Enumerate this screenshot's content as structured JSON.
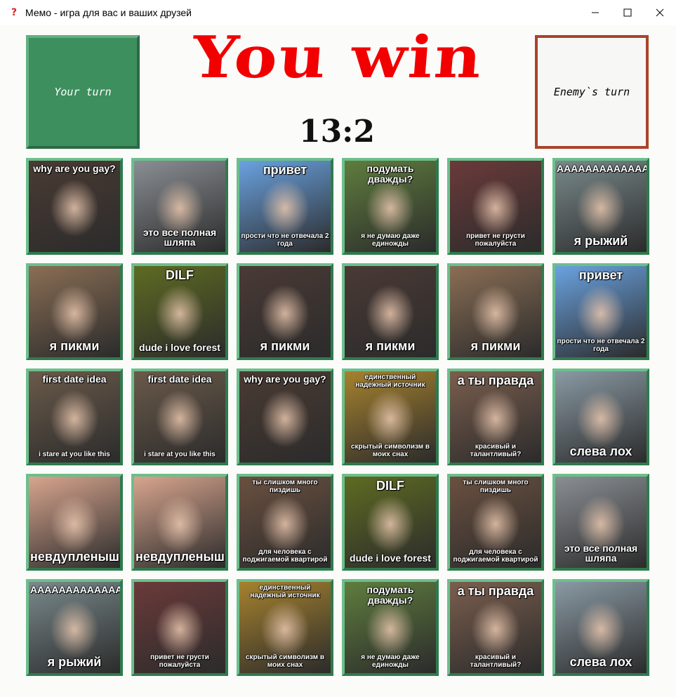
{
  "window": {
    "title": "Мемо - игра для вас и ваших друзей",
    "icon": "question-icon"
  },
  "status": {
    "your_turn_label": "Your turn",
    "enemy_turn_label": "Enemy`s turn",
    "headline": "You win",
    "score": "13:2"
  },
  "colors": {
    "active_turn": "#3d8f5e",
    "enemy_border": "#a9442b",
    "headline": "#f20000",
    "card_border": "#4a9d6a"
  },
  "cards": [
    [
      {
        "top": "why are you gay?",
        "bottom": "",
        "bg": "#4a3b33"
      },
      {
        "top": "",
        "bottom": "это все полная шляпа",
        "bg": "#8a8f94"
      },
      {
        "top": "привет",
        "bottom": "прости что не отвечала 2 года",
        "bg": "#6aa2e0"
      },
      {
        "top": "подумать дважды?",
        "bottom": "я не думаю даже единожды",
        "bg": "#5f7d3e"
      },
      {
        "top": "",
        "bottom": "привет не грусти пожалуйста",
        "bg": "#6b3a3a"
      },
      {
        "top": "АААААААААААААААА",
        "bottom": "я рыжий",
        "bg": "#7a8a8c"
      }
    ],
    [
      {
        "top": "",
        "bottom": "я пикми",
        "bg": "#8a6e55"
      },
      {
        "top": "DILF",
        "bottom": "dude i love forest",
        "bg": "#5e6b22"
      },
      {
        "top": "",
        "bottom": "я пикми",
        "bg": "#4a3a35"
      },
      {
        "top": "",
        "bottom": "я пикми",
        "bg": "#4a3a35"
      },
      {
        "top": "",
        "bottom": "я пикми",
        "bg": "#8a6e55"
      },
      {
        "top": "привет",
        "bottom": "прости что не отвечала 2 года",
        "bg": "#6aa2e0"
      }
    ],
    [
      {
        "top": "first date idea",
        "bottom": "i stare at you like this",
        "bg": "#6a5a4a"
      },
      {
        "top": "first date idea",
        "bottom": "i stare at you like this",
        "bg": "#6a5a4a"
      },
      {
        "top": "why are you gay?",
        "bottom": "",
        "bg": "#4a3b33"
      },
      {
        "top": "единственный надежный источник",
        "bottom": "скрытый символизм в моих снах",
        "bg": "#a6822e"
      },
      {
        "top": "а ты правда",
        "bottom": "красивый и талантливый?",
        "bg": "#7a5e4e"
      },
      {
        "top": "",
        "bottom": "слева лох",
        "bg": "#8a9aa4"
      }
    ],
    [
      {
        "top": "",
        "bottom": "невдупленыш",
        "bg": "#d8a58e"
      },
      {
        "top": "",
        "bottom": "невдупленыш",
        "bg": "#d8a58e"
      },
      {
        "top": "ты слишком много пиздишь",
        "bottom": "для человека с поджигаемой квартирой",
        "bg": "#6a5040"
      },
      {
        "top": "DILF",
        "bottom": "dude i love forest",
        "bg": "#5e6b22"
      },
      {
        "top": "ты слишком много пиздишь",
        "bottom": "для человека с поджигаемой квартирой",
        "bg": "#6a5040"
      },
      {
        "top": "",
        "bottom": "это все полная шляпа",
        "bg": "#8a8f94"
      }
    ],
    [
      {
        "top": "АААААААААААААААА",
        "bottom": "я рыжий",
        "bg": "#7a8a8c"
      },
      {
        "top": "",
        "bottom": "привет не грусти пожалуйста",
        "bg": "#6b3a3a"
      },
      {
        "top": "единственный надежный источник",
        "bottom": "скрытый символизм в моих снах",
        "bg": "#a6822e"
      },
      {
        "top": "подумать дважды?",
        "bottom": "я не думаю даже единожды",
        "bg": "#5f7d3e"
      },
      {
        "top": "а ты правда",
        "bottom": "красивый и талантливый?",
        "bg": "#7a5e4e"
      },
      {
        "top": "",
        "bottom": "слева лох",
        "bg": "#8a9aa4"
      }
    ]
  ]
}
